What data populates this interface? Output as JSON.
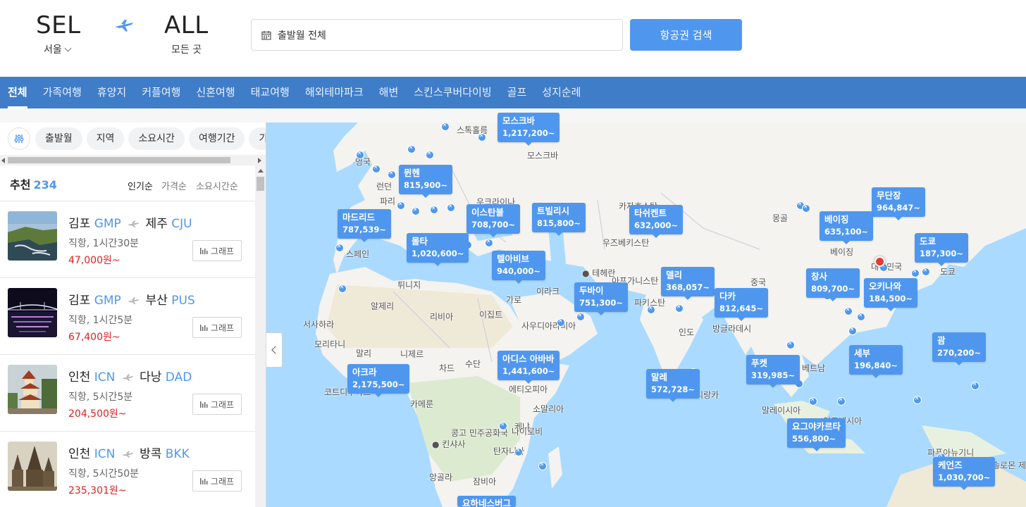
{
  "header": {
    "origin_code": "SEL",
    "origin_city": "서울",
    "destination_code": "ALL",
    "destination_city": "모든 곳",
    "date_placeholder": "출발월 전체",
    "search_label": "항공권 검색",
    "accent_color": "#4f97ee"
  },
  "categories": [
    {
      "label": "전체",
      "active": true
    },
    {
      "label": "가족여행"
    },
    {
      "label": "휴양지"
    },
    {
      "label": "커플여행"
    },
    {
      "label": "신혼여행"
    },
    {
      "label": "태교여행"
    },
    {
      "label": "해외테마파크"
    },
    {
      "label": "해변"
    },
    {
      "label": "스킨스쿠버다이빙"
    },
    {
      "label": "골프"
    },
    {
      "label": "성지순례"
    }
  ],
  "filters": {
    "chips": [
      "출발월",
      "지역",
      "소요시간",
      "여행기간",
      "가"
    ]
  },
  "list": {
    "title": "추천",
    "count": "234",
    "sort_options": [
      "인기순",
      "가격순",
      "소요시간순"
    ],
    "graph_label": "그래프",
    "items": [
      {
        "from_city": "김포",
        "from_code": "GMP",
        "to_city": "제주",
        "to_code": "CJU",
        "duration": "직항, 1시간30분",
        "price": "47,000원~"
      },
      {
        "from_city": "김포",
        "from_code": "GMP",
        "to_city": "부산",
        "to_code": "PUS",
        "duration": "직항, 1시간5분",
        "price": "67,400원~"
      },
      {
        "from_city": "인천",
        "from_code": "ICN",
        "to_city": "다낭",
        "to_code": "DAD",
        "duration": "직항, 5시간5분",
        "price": "204,500원~"
      },
      {
        "from_city": "인천",
        "from_code": "ICN",
        "to_city": "방콕",
        "to_code": "BKK",
        "duration": "직항, 5시간50분",
        "price": "235,301원~"
      }
    ]
  },
  "map": {
    "labels": [
      "스톡홀름",
      "영국",
      "런던",
      "파리",
      "우크라이나",
      "카자흐스탄",
      "몽골",
      "베이징",
      "우즈베키스탄",
      "스페인",
      "튀니지",
      "알제리",
      "리비아",
      "이집트",
      "이라크",
      "테헤란",
      "아프가니스탄",
      "파키스탄",
      "인도",
      "중국",
      "방글라데시",
      "사우디아라비아",
      "서사하라",
      "모리타니",
      "말리",
      "니제르",
      "차드",
      "수단",
      "에티오피아",
      "소말리아",
      "코트디부아르",
      "카메룬",
      "콩고 민주공화국",
      "킨샤사",
      "탄자니아",
      "케냐",
      "나이로비",
      "앙골라",
      "잠비아",
      "대한민국",
      "도쿄",
      "베트남",
      "말레이시아",
      "파푸아뉴기니",
      "솔로몬 제",
      "스리랑카",
      "모스크바",
      "인도네시아",
      "가로"
    ],
    "bubbles": [
      {
        "name": "모스크바",
        "price": "1,217,200~"
      },
      {
        "name": "뮌헨",
        "price": "815,900~"
      },
      {
        "name": "마드리드",
        "price": "787,539~"
      },
      {
        "name": "이스탄불",
        "price": "708,700~"
      },
      {
        "name": "트빌리시",
        "price": "815,800~"
      },
      {
        "name": "타쉬켄트",
        "price": "632,000~"
      },
      {
        "name": "무단장",
        "price": "964,847~"
      },
      {
        "name": "베이징",
        "price": "635,100~"
      },
      {
        "name": "도쿄",
        "price": "187,300~"
      },
      {
        "name": "몰타",
        "price": "1,020,600~"
      },
      {
        "name": "텔아비브",
        "price": "940,000~"
      },
      {
        "name": "델리",
        "price": "368,057~"
      },
      {
        "name": "창사",
        "price": "809,700~"
      },
      {
        "name": "오키나와",
        "price": "184,500~"
      },
      {
        "name": "두바이",
        "price": "751,300~"
      },
      {
        "name": "다카",
        "price": "812,645~"
      },
      {
        "name": "괌",
        "price": "270,200~"
      },
      {
        "name": "세부",
        "price": "196,840~"
      },
      {
        "name": "아디스 아바바",
        "price": "1,441,600~"
      },
      {
        "name": "아크라",
        "price": "2,175,500~"
      },
      {
        "name": "말레",
        "price": "572,728~"
      },
      {
        "name": "푸켓",
        "price": "319,985~"
      },
      {
        "name": "요그야카르타",
        "price": "556,800~"
      },
      {
        "name": "케언즈",
        "price": "1,030,700~"
      },
      {
        "name": "요하네스버그",
        "price": ""
      }
    ]
  }
}
